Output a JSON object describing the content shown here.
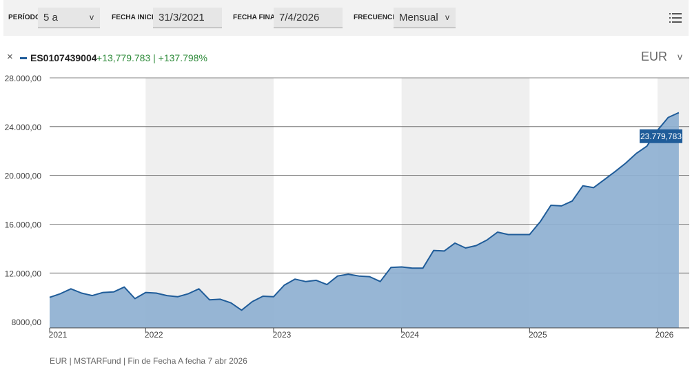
{
  "toolbar": {
    "period_label": "PERÍODO",
    "period_value": "5 a",
    "start_label": "FECHA INICIO",
    "start_value": "31/3/2021",
    "end_label": "FECHA FINAL",
    "end_value": "7/4/2026",
    "freq_label": "FRECUENCIA",
    "freq_value": "Mensual",
    "chevron": "v",
    "menu_icon": "list-icon"
  },
  "legend": {
    "close": "×",
    "series_name": "ES0107439004",
    "change": "+13,779.783 | +137.798%",
    "currency": "EUR",
    "currency_chevron": "v"
  },
  "chart_data": {
    "type": "area",
    "ylim": [
      7500,
      28000
    ],
    "yticks": [
      "28.000,00",
      "24.000,00",
      "20.000,00",
      "16.000,00",
      "12.000,00",
      "8000,00"
    ],
    "ytick_values": [
      28000,
      24000,
      20000,
      16000,
      12000,
      8000
    ],
    "year_labels": [
      "2021",
      "2022",
      "2023",
      "2024",
      "2025",
      "2026"
    ],
    "x": [
      "2021-04",
      "2021-05",
      "2021-06",
      "2021-07",
      "2021-08",
      "2021-09",
      "2021-10",
      "2021-11",
      "2021-12",
      "2022-01",
      "2022-02",
      "2022-03",
      "2022-04",
      "2022-05",
      "2022-06",
      "2022-07",
      "2022-08",
      "2022-09",
      "2022-10",
      "2022-11",
      "2022-12",
      "2023-01",
      "2023-02",
      "2023-03",
      "2023-04",
      "2023-05",
      "2023-06",
      "2023-07",
      "2023-08",
      "2023-09",
      "2023-10",
      "2023-11",
      "2023-12",
      "2024-01",
      "2024-02",
      "2024-03",
      "2024-04",
      "2024-05",
      "2024-06",
      "2024-07",
      "2024-08",
      "2024-09",
      "2024-10",
      "2024-11",
      "2024-12",
      "2025-01",
      "2025-02",
      "2025-03",
      "2025-04",
      "2025-05",
      "2025-06",
      "2025-07",
      "2025-08",
      "2025-09",
      "2025-10",
      "2025-11",
      "2025-12",
      "2026-01",
      "2026-02",
      "2026-03",
      "2026-04"
    ],
    "series": [
      {
        "values": [
          10000,
          10300,
          10700,
          10350,
          10150,
          10400,
          10450,
          10850,
          9900,
          10400,
          10350,
          10150,
          10050,
          10300,
          10700,
          9800,
          9850,
          9550,
          8950,
          9650,
          10100,
          10050,
          11000,
          11500,
          11300,
          11400,
          11050,
          11750,
          11900,
          11750,
          11700,
          11300,
          12450,
          12500,
          12400,
          12400,
          13850,
          13800,
          14450,
          14050,
          14250,
          14700,
          15350,
          15150,
          15150,
          15150,
          16200,
          17550,
          17500,
          17900,
          19150,
          19000,
          19650,
          20300,
          21000,
          21800,
          22400,
          23700,
          24750,
          25150,
          23400,
          23780
        ],
        "color": "#1f5c99",
        "fill": "#8eb0d1"
      }
    ],
    "last_value_label": "23.779,783",
    "grid": true,
    "alternating_year_bands": true
  },
  "footer": "EUR | MSTARFund | Fin de Fecha A fecha 7 abr 2026"
}
